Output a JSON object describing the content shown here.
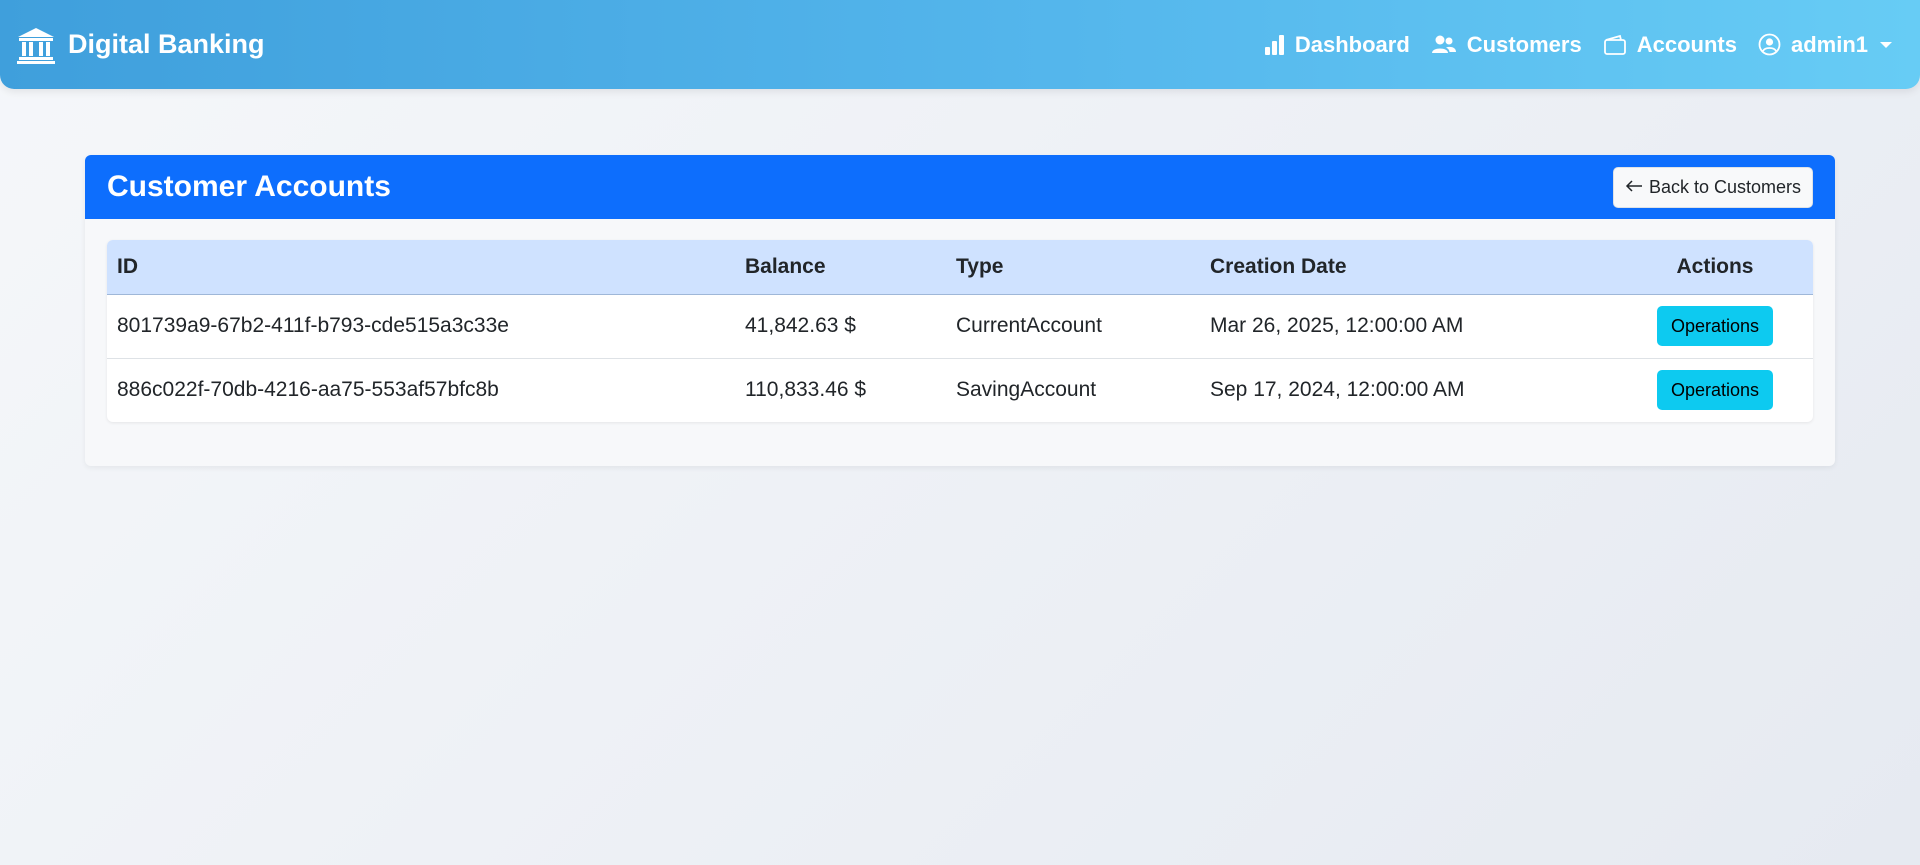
{
  "navbar": {
    "brand": "Digital Banking",
    "links": [
      {
        "label": "Dashboard",
        "icon": "bar-chart-icon"
      },
      {
        "label": "Customers",
        "icon": "people-icon"
      },
      {
        "label": "Accounts",
        "icon": "wallet-icon"
      }
    ],
    "user": "admin1"
  },
  "card": {
    "title": "Customer Accounts",
    "back_label": "Back to Customers"
  },
  "table": {
    "headers": [
      "ID",
      "Balance",
      "Type",
      "Creation Date",
      "Actions"
    ],
    "rows": [
      {
        "id": "801739a9-67b2-411f-b793-cde515a3c33e",
        "balance": "41,842.63 $",
        "type": "CurrentAccount",
        "date": "Mar 26, 2025, 12:00:00 AM",
        "action": "Operations"
      },
      {
        "id": "886c022f-70db-4216-aa75-553af57bfc8b",
        "balance": "110,833.46 $",
        "type": "SavingAccount",
        "date": "Sep 17, 2024, 12:00:00 AM",
        "action": "Operations"
      }
    ]
  },
  "colors": {
    "header_blue": "#0d6efd",
    "table_header": "#cfe2ff",
    "operations_button": "#0dcaf0"
  }
}
